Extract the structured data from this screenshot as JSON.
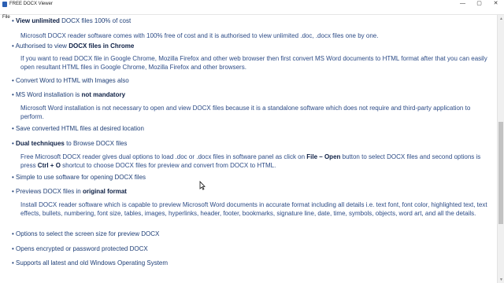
{
  "window": {
    "title": "FREE DOCX Viewer",
    "minimize": "—",
    "maximize": "▢",
    "close": "✕"
  },
  "menu": {
    "file": "File"
  },
  "features": [
    {
      "pre": "",
      "bold": "View unlimited",
      "post": " DOCX files 100% of cost",
      "desc": "Microsoft DOCX reader software comes with 100% free of cost and it is authorised to view unlimited .doc, .docx files one by one."
    },
    {
      "pre": "Authorised to view ",
      "bold": "DOCX files in Chrome",
      "post": "",
      "desc": "If you want to read DOCX file in Google Chrome, Mozilla Firefox and other web browser then first convert MS Word documents to HTML format after that you can easily open resultant HTML files in Google Chrome, Mozilla Firefox and other browsers."
    },
    {
      "pre": "Convert Word to HTML with Images also",
      "bold": "",
      "post": "",
      "desc": ""
    },
    {
      "pre": "MS Word installation is ",
      "bold": "not mandatory",
      "post": "",
      "desc": "Microsoft Word installation is not necessary to open and view DOCX files because it is a standalone software which does not require and third-party application to perform."
    },
    {
      "pre": "Save converted HTML files at desired location",
      "bold": "",
      "post": "",
      "desc": ""
    },
    {
      "pre": "",
      "bold": "Dual techniques",
      "post": " to Browse DOCX files",
      "desc_parts": {
        "a": "Free Microsoft DOCX reader gives dual options to load .doc or .docx files in software panel as click on ",
        "b": "File – Open",
        "c": " button to select DOCX files and second options is press ",
        "d": "Ctrl + O",
        "e": " shortcut to choose DOCX files for preview and convert from DOCX to HTML."
      }
    },
    {
      "pre": "Simple to use software for opening DOCX files",
      "bold": "",
      "post": "",
      "desc": ""
    },
    {
      "pre": "Previews DOCX files in ",
      "bold": "original format",
      "post": "",
      "desc": "Install DOCX reader software which is capable to preview Microsoft Word documents in accurate format including all details i.e. text font, font color, highlighted text, text effects, bullets, numbering, font size, tables, images, hyperlinks, header, footer, bookmarks, signature line, date, time, symbols, objects, word art, and all the details."
    },
    {
      "pre": "Options to select the screen size for preview DOCX",
      "bold": "",
      "post": "",
      "desc": ""
    },
    {
      "pre": "Opens encrypted or password protected DOCX",
      "bold": "",
      "post": "",
      "desc": ""
    },
    {
      "pre": "Supports all latest and old Windows Operating System",
      "bold": "",
      "post": "",
      "desc": ""
    }
  ],
  "bullet_char": "•",
  "scrollbar": {
    "up": "▲",
    "down": "▼"
  }
}
